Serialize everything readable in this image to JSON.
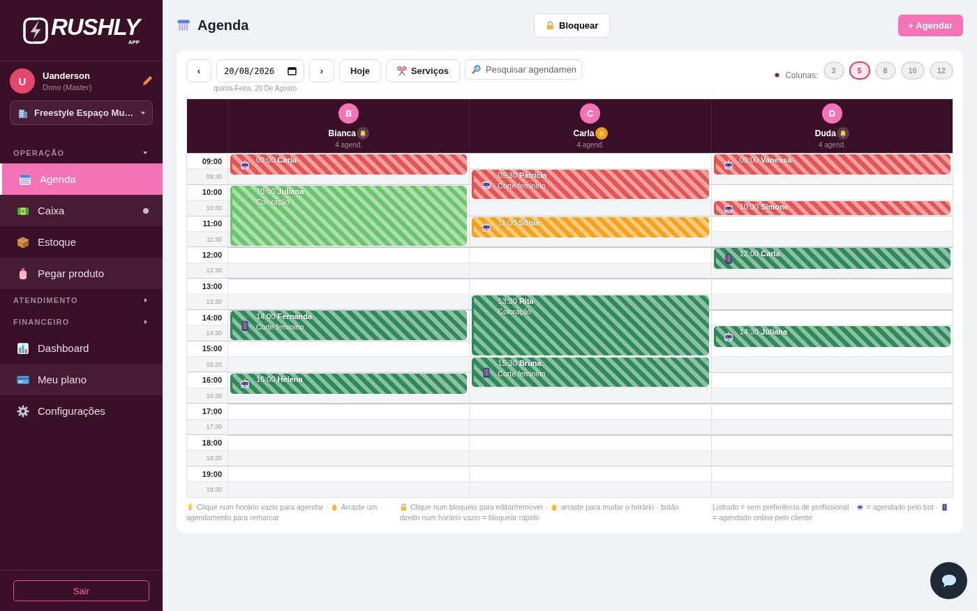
{
  "logo": {
    "name": "RUSHLY",
    "sub": "APP"
  },
  "user": {
    "initial": "U",
    "name": "Uanderson",
    "role": "Dono (Master)"
  },
  "store": {
    "name": "Freestyle Espaço Mu…"
  },
  "sections": [
    {
      "title": "OPERAÇÃO",
      "expanded": true,
      "items": [
        {
          "label": "Agenda",
          "kind": "calendar",
          "selected": true,
          "dot": false
        },
        {
          "label": "Caixa",
          "kind": "money",
          "selected": false,
          "dot": true
        },
        {
          "label": "Estoque",
          "kind": "box",
          "selected": false,
          "dot": false
        },
        {
          "label": "Pegar produto",
          "kind": "bottle",
          "selected": false,
          "dot": false
        }
      ]
    },
    {
      "title": "ATENDIMENTO",
      "expanded": false
    },
    {
      "title": "FINANCEIRO",
      "expanded": false,
      "items": [
        {
          "label": "Dashboard",
          "kind": "chart",
          "selected": false,
          "dot": false
        },
        {
          "label": "Meu plano",
          "kind": "card",
          "selected": false,
          "dot": false
        },
        {
          "label": "Configurações",
          "kind": "gear",
          "selected": false,
          "dot": false
        }
      ]
    }
  ],
  "logout": "Sair",
  "page": {
    "title": "Agenda",
    "block_button": "Bloquear",
    "new_button": "+ Agendar"
  },
  "toolbar": {
    "prev": "‹",
    "date": "20/08/2026",
    "next": "›",
    "today": "Hoje",
    "services": "Serviços",
    "search_placeholder": "Pesquisar agendamen",
    "date_caption": "quinta-Feira, 20 De Agosto",
    "columns_label": "Colunas:",
    "column_options": [
      {
        "label": "3",
        "selected": false
      },
      {
        "label": "5",
        "selected": true
      },
      {
        "label": "8",
        "selected": false
      },
      {
        "label": "10",
        "selected": false
      },
      {
        "label": "12",
        "selected": false
      }
    ]
  },
  "times": [
    {
      "label": "09:00",
      "kind": "hour"
    },
    {
      "label": "09:30",
      "kind": "half"
    },
    {
      "label": "10:00",
      "kind": "hour"
    },
    {
      "label": "10:30",
      "kind": "half"
    },
    {
      "label": "11:00",
      "kind": "hour"
    },
    {
      "label": "11:30",
      "kind": "half"
    },
    {
      "label": "12:00",
      "kind": "hour"
    },
    {
      "label": "12:30",
      "kind": "half"
    },
    {
      "label": "13:00",
      "kind": "hour"
    },
    {
      "label": "13:30",
      "kind": "half"
    },
    {
      "label": "14:00",
      "kind": "hour"
    },
    {
      "label": "14:30",
      "kind": "half"
    },
    {
      "label": "15:00",
      "kind": "hour"
    },
    {
      "label": "15:30",
      "kind": "half"
    },
    {
      "label": "16:00",
      "kind": "hour"
    },
    {
      "label": "16:30",
      "kind": "half"
    },
    {
      "label": "17:00",
      "kind": "hour"
    },
    {
      "label": "17:30",
      "kind": "half"
    },
    {
      "label": "18:00",
      "kind": "hour"
    },
    {
      "label": "18:30",
      "kind": "half"
    },
    {
      "label": "19:00",
      "kind": "hour"
    },
    {
      "label": "19:30",
      "kind": "half"
    }
  ],
  "professionals": [
    {
      "initial": "B",
      "name": "Bianca",
      "count": "4 agend.",
      "alert": false,
      "appointments": [
        {
          "start": "09:00",
          "kind": "short",
          "client": "Carla",
          "color": "#e35454",
          "striped": true,
          "icon": {
            "kind": "bot"
          }
        },
        {
          "start": "10:00",
          "kind": "long",
          "client": "Juliana",
          "service": "Coloração",
          "color": "#6cc46c",
          "striped": true
        },
        {
          "start": "14:00",
          "kind": "hour",
          "client": "Fernanda",
          "service": "Corte feminino",
          "color": "#2f8a5b",
          "striped": true,
          "icon": {
            "kind": "online"
          }
        },
        {
          "start": "16:00",
          "kind": "short",
          "client": "Helena",
          "color": "#2f8a5b",
          "striped": true,
          "icon": {
            "kind": "bot"
          }
        }
      ]
    },
    {
      "initial": "C",
      "name": "Carla",
      "count": "4 agend.",
      "alert": true,
      "appointments": [
        {
          "start": "09:30",
          "kind": "hour",
          "client": "Patrícia",
          "service": "Corte feminino",
          "color": "#e35454",
          "striped": true,
          "icon": {
            "kind": "bot"
          }
        },
        {
          "start": "11:00",
          "kind": "short",
          "client": "Sônia",
          "color": "#f7a21b",
          "striped": true,
          "icon": {
            "kind": "bot"
          }
        },
        {
          "start": "13:30",
          "kind": "long",
          "client": "Rita",
          "service": "Coloração",
          "color": "#2f8a5b",
          "striped": true
        },
        {
          "start": "15:30",
          "kind": "hour",
          "client": "Bruna",
          "service": "Corte feminino",
          "color": "#2f8a5b",
          "striped": true,
          "icon": {
            "kind": "online"
          }
        }
      ]
    },
    {
      "initial": "D",
      "name": "Duda",
      "count": "4 agend.",
      "alert": false,
      "appointments": [
        {
          "start": "09:00",
          "kind": "short",
          "client": "Vanessa",
          "color": "#e35454",
          "striped": true,
          "icon": {
            "kind": "bot"
          }
        },
        {
          "start": "10:30",
          "kind": "half",
          "client": "Simone",
          "color": "#e35454",
          "striped": true,
          "icon": {
            "kind": "bot"
          }
        },
        {
          "start": "12:00",
          "kind": "short",
          "client": "Carla",
          "color": "#2f8a5b",
          "striped": true,
          "icon": {
            "kind": "online"
          }
        },
        {
          "start": "14:30",
          "kind": "short",
          "client": "Juliana",
          "color": "#2f8a5b",
          "striped": true,
          "icon": {
            "kind": "bot"
          }
        }
      ]
    }
  ],
  "hints": [
    [
      {
        "kind": "bulb"
      },
      {
        "text": "Clique num horário vazio para agendar ·"
      },
      {
        "kind": "hand"
      },
      {
        "text": "Arraste um"
      },
      {
        "text": "agendamento para remarcar"
      }
    ],
    [
      {
        "kind": "lock"
      },
      {
        "text": "Clique num bloqueio para editar/remover ·"
      },
      {
        "kind": "hand"
      },
      {
        "text": "arraste para mudar o horário · botão"
      },
      {
        "text": "direito num horário vazio = bloquear rápido"
      }
    ],
    [
      {
        "text": "Listrado = sem preferência de profissional ·"
      },
      {
        "kind": "bot"
      },
      {
        "text": "= agendado pelo bot ·"
      },
      {
        "kind": "online"
      },
      {
        "text": "= agendado online pelo cliente"
      }
    ]
  ]
}
